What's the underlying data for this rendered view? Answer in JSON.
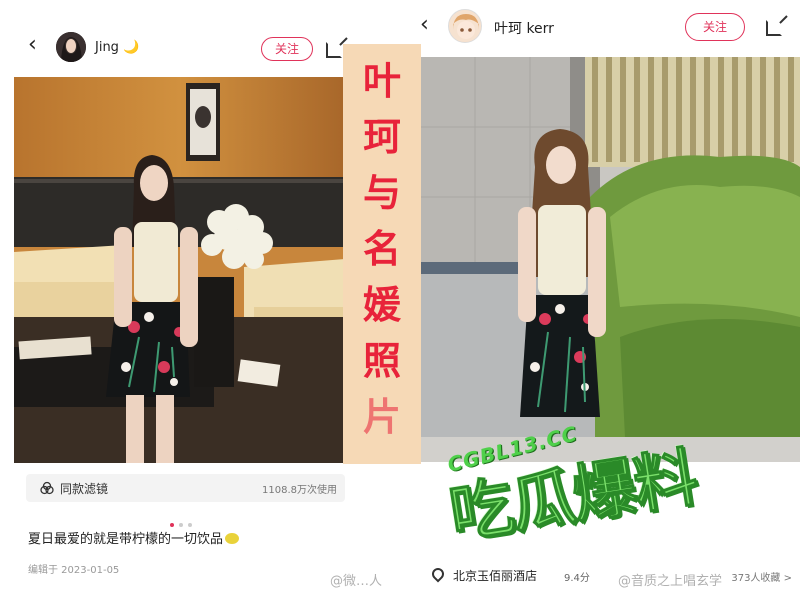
{
  "left_post": {
    "back_glyph": "‹",
    "username": "Jing 🌙",
    "follow_label": "关注",
    "filter_label": "同款滤镜",
    "filter_count": "1108.8万次使用",
    "carousel_dots": 3,
    "caption": "夏日最爱的就是带柠檬的一切饮品",
    "edit_date": "编辑于 2023-01-05"
  },
  "right_post": {
    "back_glyph": "‹",
    "username": "叶珂 kerr",
    "follow_label": "关注",
    "location": "北京玉佰丽酒店",
    "rating": "9.4分",
    "count": "373人收藏 >"
  },
  "overlay": {
    "vertical_caption": [
      "叶",
      "珂",
      "与",
      "名",
      "媛",
      "照",
      "片"
    ],
    "caption_color": "#e8233a"
  },
  "watermarks": {
    "green_sub": "CGBL13.CC",
    "green_main": "吃瓜爆料",
    "weibo_left": "@微…人",
    "weibo_right": "@音质之上唱玄学"
  },
  "colors": {
    "accent": "#e0335a"
  }
}
